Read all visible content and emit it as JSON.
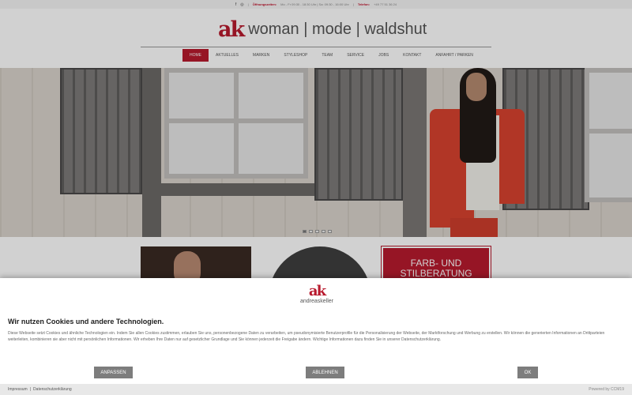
{
  "topbar": {
    "facebook_icon": "f",
    "instagram_icon": "◎",
    "opening_label": "Öffnungszeiten:",
    "opening_value": "Mo - Fr 09:30 - 18:30 Uhr | Sa: 09:30 - 16:00 Uhr",
    "phone_label": "Telefon:",
    "phone_value": "+49 77 51 36 24"
  },
  "header": {
    "logo_mark": "ak",
    "logo_text": "woman | mode | waldshut"
  },
  "nav": {
    "items": [
      "HOME",
      "AKTUELLES",
      "MARKEN",
      "STYLESHOP",
      "TEAM",
      "SERVICE",
      "JOBS",
      "KONTAKT",
      "ANFAHRT / PARKEN"
    ],
    "active_index": 0
  },
  "hero": {
    "slides_count": 5,
    "active_slide": 1
  },
  "tiles": {
    "red_tile_text": "FARB- UND STILBERATUNG"
  },
  "cookie": {
    "logo_mark": "ak",
    "logo_name": "andreaskeller",
    "title": "Wir nutzen Cookies und andere Technologien.",
    "text": "Diese Webseite setzt Cookies und ähnliche Technologien ein. Indem Sie allen Cookies zustimmen, erlauben Sie uns, personenbezogene Daten zu verarbeiten, um pseudonymisierte Benutzerprofile für die Personalisierung der Webseite, der Marktforschung und Werbung zu erstellen. Wir können die generierten Informationen an Drittparteien weiterleiten, kombinieren sie aber nicht mit persönlichen Informationen. Wir erheben Ihre Daten nur auf gesetzlicher Grundlage und Sie können jederzeit die Freigabe ändern. Wichtige Informationen dazu finden Sie in unserer Datenschutzerklärung.",
    "btn_customize": "ANPASSEN",
    "btn_reject": "ABLEHNEN",
    "btn_ok": "OK"
  },
  "footer": {
    "imprint": "Impressum",
    "separator": "|",
    "privacy": "Datenschutzerklärung",
    "powered": "Powered by CCM19"
  },
  "colors": {
    "brand_red": "#b81a2e",
    "button_grey": "#7d7d7d"
  }
}
